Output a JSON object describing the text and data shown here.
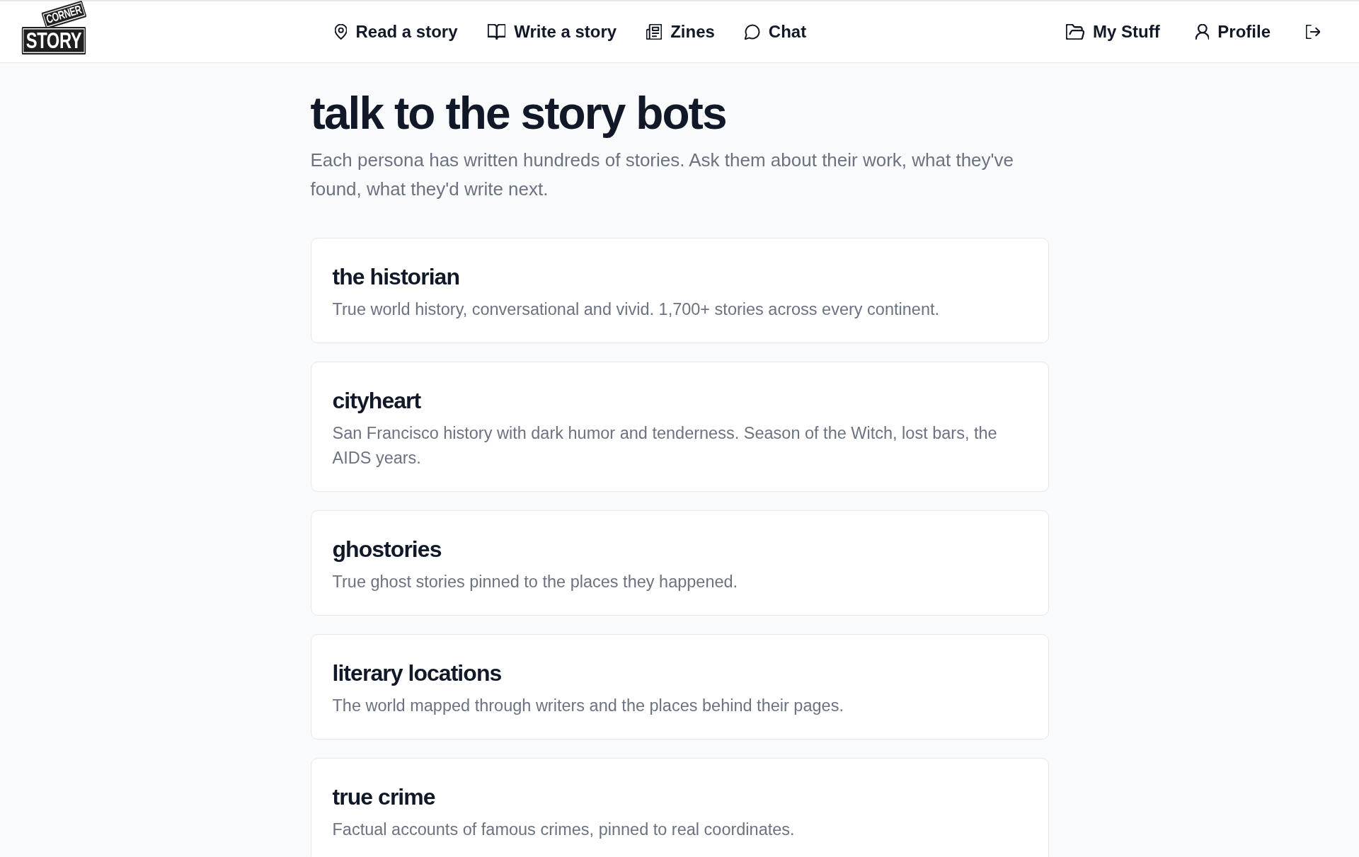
{
  "header": {
    "logo": {
      "top_sign": "CORNER",
      "bottom_sign": "STORY"
    },
    "nav": [
      "Read a story",
      "Write a story",
      "Zines",
      "Chat"
    ],
    "account": [
      "My Stuff",
      "Profile"
    ]
  },
  "page": {
    "title": "talk to the story bots",
    "intro": "Each persona has written hundreds of stories. Ask them about their work, what they've found, what they'd write next."
  },
  "personas": [
    {
      "name": "the historian",
      "description": "True world history, conversational and vivid. 1,700+ stories across every continent."
    },
    {
      "name": "cityheart",
      "description": "San Francisco history with dark humor and tenderness. Season of the Witch, lost bars, the AIDS years."
    },
    {
      "name": "ghostories",
      "description": "True ghost stories pinned to the places they happened."
    },
    {
      "name": "literary locations",
      "description": "The world mapped through writers and the places behind their pages."
    },
    {
      "name": "true crime",
      "description": "Factual accounts of famous crimes, pinned to real coordinates."
    }
  ]
}
